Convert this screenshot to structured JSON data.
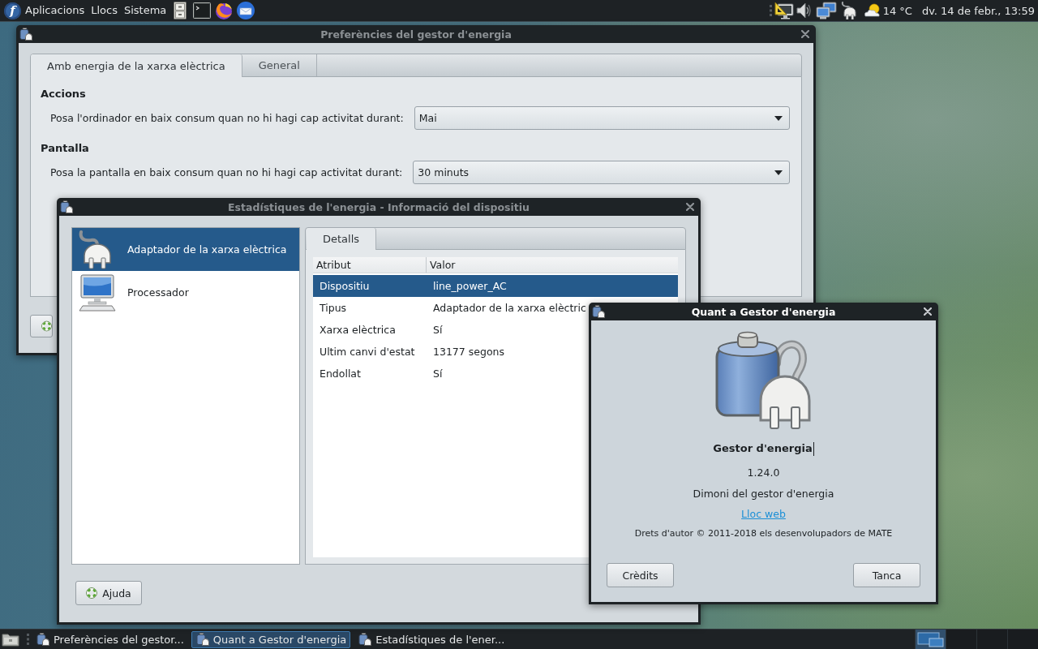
{
  "top_panel": {
    "logo_letter": "f",
    "menus": [
      "Aplicacions",
      "Llocs",
      "Sistema"
    ],
    "temperature": "14 °C",
    "clock": "dv. 14 de febr., 13:59"
  },
  "preferences_window": {
    "title": "Preferències del gestor d'energia",
    "active": false,
    "tabs": [
      {
        "label": "Amb energia de la xarxa elèctrica",
        "selected": true
      },
      {
        "label": "General",
        "selected": false
      }
    ],
    "sections": [
      {
        "heading": "Accions",
        "rows": [
          {
            "label": "Posa l'ordinador en baix consum quan no hi hagi cap activitat durant:",
            "value": "Mai"
          }
        ]
      },
      {
        "heading": "Pantalla",
        "rows": [
          {
            "label": "Posa la pantalla en baix consum quan no hi hagi cap activitat durant:",
            "value": "30 minuts"
          }
        ]
      }
    ]
  },
  "statistics_window": {
    "title": "Estadístiques de l'energia - Informació del dispositiu",
    "active": false,
    "devices": [
      {
        "kind": "plug",
        "label": "Adaptador de la xarxa elèctrica",
        "selected": true
      },
      {
        "kind": "computer",
        "label": "Processador",
        "selected": false
      }
    ],
    "tabs": [
      {
        "label": "Detalls",
        "selected": true
      }
    ],
    "table": {
      "columns": [
        "Atribut",
        "Valor"
      ],
      "rows": [
        {
          "cells": [
            "Dispositiu",
            "line_power_AC"
          ],
          "selected": true
        },
        {
          "cells": [
            "Tipus",
            "Adaptador de la xarxa elèctric"
          ],
          "selected": false
        },
        {
          "cells": [
            "Xarxa elèctrica",
            "Sí"
          ],
          "selected": false
        },
        {
          "cells": [
            "Ultim canvi d'estat",
            "13177 segons"
          ],
          "selected": false
        },
        {
          "cells": [
            "Endollat",
            "Sí"
          ],
          "selected": false
        }
      ]
    },
    "help_button": "Ajuda"
  },
  "about_window": {
    "title": "Quant a Gestor d'energia",
    "active": true,
    "program_name": "Gestor d'energia",
    "program_name_focused": true,
    "version": "1.24.0",
    "comments": "Dimoni del gestor d'energia",
    "website_link": "Lloc web",
    "copyright": "Drets d'autor © 2011-2018 els desenvolupadors de MATE",
    "buttons": [
      "Crèdits",
      "Tanca"
    ]
  },
  "taskbar": {
    "tasks": [
      {
        "label": "Preferències del gestor...",
        "selected": false
      },
      {
        "label": "Quant a Gestor d'energia",
        "selected": true
      },
      {
        "label": "Estadístiques de l'ener...",
        "selected": false
      }
    ],
    "workspaces": [
      {
        "selected": true
      },
      {
        "selected": false
      },
      {
        "selected": false
      },
      {
        "selected": false
      }
    ]
  }
}
